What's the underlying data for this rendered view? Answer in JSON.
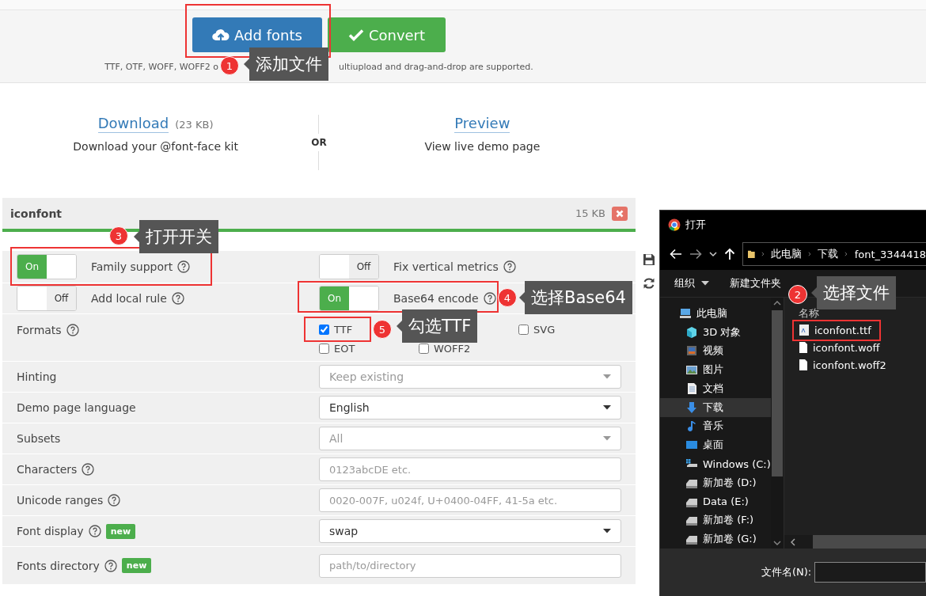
{
  "toolbar": {
    "buttons": [
      {
        "kind": "upload",
        "label": "Add fonts"
      },
      {
        "kind": "convert",
        "label": "Convert"
      }
    ],
    "hint_parts": [
      "TTF, OTF, WOFF, WOFF2 o",
      "ultiupload and drag-and-drop are supported."
    ]
  },
  "downloads": {
    "download": {
      "link": "Download",
      "size": "(23 KB)",
      "caption": "Download your @font-face kit"
    },
    "separator": "OR",
    "preview": {
      "link": "Preview",
      "caption": "View live demo page"
    }
  },
  "font_panel": {
    "name": "iconfont",
    "size": "15 KB",
    "settings": [
      {
        "kind": "toggles",
        "toggles": [
          {
            "on": true,
            "switch_text": "On",
            "label": "Family support",
            "help": true
          },
          {
            "on": false,
            "switch_text": "Off",
            "label": "Fix vertical metrics",
            "help": true
          }
        ]
      },
      {
        "kind": "toggles",
        "toggles": [
          {
            "on": false,
            "switch_text": "Off",
            "label": "Add local rule",
            "help": true
          },
          {
            "on": true,
            "switch_text": "On",
            "label": "Base64 encode",
            "help": true
          }
        ]
      },
      {
        "kind": "checkboxes",
        "label": "Formats",
        "help": true,
        "options": [
          {
            "label": "TTF",
            "checked": true
          },
          {
            "label": "SVG",
            "checked": false
          },
          {
            "label": "EOT",
            "checked": false
          },
          {
            "label": "WOFF2",
            "checked": false
          }
        ]
      },
      {
        "kind": "select",
        "label": "Hinting",
        "help": false,
        "value": "Keep existing",
        "disabled": true
      },
      {
        "kind": "select",
        "label": "Demo page language",
        "help": false,
        "value": "English",
        "disabled": false
      },
      {
        "kind": "select",
        "label": "Subsets",
        "help": false,
        "value": "All",
        "disabled": true
      },
      {
        "kind": "text",
        "label": "Characters",
        "help": true,
        "placeholder": "0123abcDE etc."
      },
      {
        "kind": "text",
        "label": "Unicode ranges",
        "help": true,
        "placeholder": "0020-007F, u024f, U+0400-04FF, 41-5a etc."
      },
      {
        "kind": "select",
        "label": "Font display",
        "help": true,
        "badge": "new",
        "value": "swap",
        "disabled": false
      },
      {
        "kind": "text",
        "label": "Fonts directory",
        "help": true,
        "badge": "new",
        "placeholder": "path/to/directory"
      }
    ]
  },
  "open_dialog": {
    "title": "打开",
    "path": [
      "此电脑",
      "下载",
      "font_3344418"
    ],
    "toolbar": [
      "组织",
      "新建文件夹"
    ],
    "nav": [
      {
        "kind": "pc",
        "label": "此电脑",
        "selected": false
      },
      {
        "kind": "objects3d",
        "label": "3D 对象",
        "selected": false
      },
      {
        "kind": "video",
        "label": "视频",
        "selected": false
      },
      {
        "kind": "pictures",
        "label": "图片",
        "selected": false
      },
      {
        "kind": "documents",
        "label": "文档",
        "selected": false
      },
      {
        "kind": "downloads",
        "label": "下载",
        "selected": true
      },
      {
        "kind": "music",
        "label": "音乐",
        "selected": false
      },
      {
        "kind": "desktop",
        "label": "桌面",
        "selected": false
      },
      {
        "kind": "system-drive",
        "label": "Windows (C:)",
        "selected": false
      },
      {
        "kind": "drive",
        "label": "新加卷 (D:)",
        "selected": false
      },
      {
        "kind": "drive",
        "label": "Data (E:)",
        "selected": false
      },
      {
        "kind": "drive",
        "label": "新加卷 (F:)",
        "selected": false
      },
      {
        "kind": "drive",
        "label": "新加卷 (G:)",
        "selected": false
      }
    ],
    "column_header": "名称",
    "files": [
      {
        "kind": "font",
        "name": "iconfont.ttf"
      },
      {
        "kind": "file",
        "name": "iconfont.woff"
      },
      {
        "kind": "file",
        "name": "iconfont.woff2"
      }
    ],
    "filename_label": "文件名(N):"
  },
  "annotations": [
    {
      "number": "1",
      "text": "添加文件"
    },
    {
      "number": "2",
      "text": "选择文件"
    },
    {
      "number": "3",
      "text": "打开开关"
    },
    {
      "number": "4",
      "text": "选择Base64"
    },
    {
      "number": "5",
      "text": "勾选TTF"
    }
  ]
}
